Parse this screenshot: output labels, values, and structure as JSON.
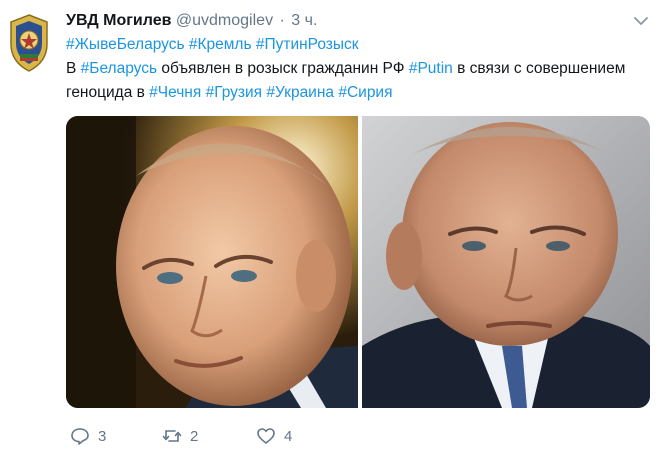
{
  "author": {
    "name": "УВД Могилев",
    "handle": "@uvdmogilev",
    "separator": "·",
    "time": "3 ч.",
    "colors": {
      "name": "#14171a",
      "meta": "#657786"
    }
  },
  "tweet": {
    "hashtags_line": [
      "#ЖывеБеларусь",
      "#Кремль",
      "#ПутинРозыск"
    ],
    "line2": {
      "t1": "В ",
      "h1": "#Беларусь",
      "t2": " объявлен в розыск гражданин РФ ",
      "h2": "#Putin",
      "t3": " в связи с совершением"
    },
    "line3": {
      "t1": "геноцида в ",
      "h1": "#Чечня",
      "h2": "#Грузия",
      "h3": "#Украина",
      "h4": "#Сирия"
    },
    "hashtag_color": "#1b95e0"
  },
  "media": {
    "photos": [
      {
        "icon": "portrait-photo-left"
      },
      {
        "icon": "portrait-photo-right"
      }
    ]
  },
  "actions": {
    "reply": {
      "icon": "reply-icon",
      "count": "3"
    },
    "retweet": {
      "icon": "retweet-icon",
      "count": "2"
    },
    "like": {
      "icon": "heart-icon",
      "count": "4"
    }
  },
  "menu": {
    "icon": "chevron-down-icon"
  }
}
